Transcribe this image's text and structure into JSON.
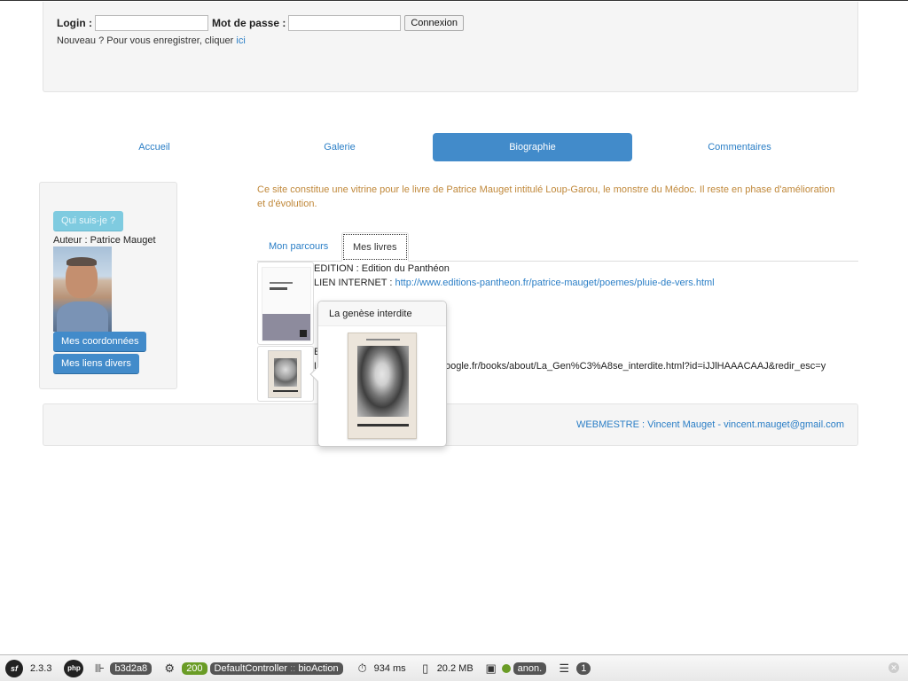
{
  "login": {
    "login_label": "Login :",
    "login_value": "",
    "password_label": "Mot de passe :",
    "password_value": "",
    "connect_button": "Connexion",
    "register_text": "Nouveau ? Pour vous enregistrer, cliquer",
    "register_link": "ici"
  },
  "nav": {
    "items": [
      {
        "label": "Accueil",
        "active": false
      },
      {
        "label": "Galerie",
        "active": false
      },
      {
        "label": "Biographie",
        "active": true
      },
      {
        "label": "Commentaires",
        "active": false
      }
    ]
  },
  "sidebar": {
    "whoami_button": "Qui suis-je ?",
    "author_label": "Auteur : Patrice Mauget",
    "contact_button": "Mes coordonnées",
    "links_button": "Mes liens divers"
  },
  "intro_text": "Ce site constitue une vitrine pour le livre de Patrice Mauget intitulé Loup-Garou, le monstre du Médoc. Il reste en phase d'amélioration et d'évolution.",
  "tabs": [
    {
      "label": "Mon parcours",
      "active": false
    },
    {
      "label": "Mes livres",
      "active": true
    }
  ],
  "books": [
    {
      "edition": "EDITION : Edition du Panthéon",
      "link_label": "LIEN INTERNET :",
      "link_url": "http://www.editions-pantheon.fr/patrice-mauget/poemes/pluie-de-vers.html"
    },
    {
      "edition_partial": "E",
      "link_label_partial": "L",
      "link_url_partial": "oogle.fr/books/about/La_Gen%C3%A8se_interdite.html?id=iJJlHAAACAAJ&redir_esc=y"
    }
  ],
  "popover": {
    "title": "La genèse interdite"
  },
  "footer": {
    "webmaster": "WEBMESTRE : Vincent Mauget - vincent.mauget@gmail.com"
  },
  "toolbar": {
    "sf_logo": "sf",
    "version": "2.3.3",
    "php_label": "php",
    "token": "b3d2a8",
    "status_code": "200",
    "controller": "DefaultController",
    "separator": "::",
    "action": "bioAction",
    "time": "934 ms",
    "memory": "20.2 MB",
    "user": "anon.",
    "queries": "1",
    "icons": {
      "config": "gear-icon",
      "time": "stopwatch-icon",
      "memory": "memory-icon",
      "security": "security-icon",
      "db": "database-icon",
      "close": "close-icon"
    }
  },
  "colors": {
    "accent": "#428bca",
    "link": "#2a7ec6",
    "intro": "#c0883a",
    "status_ok": "#6a9c26"
  }
}
